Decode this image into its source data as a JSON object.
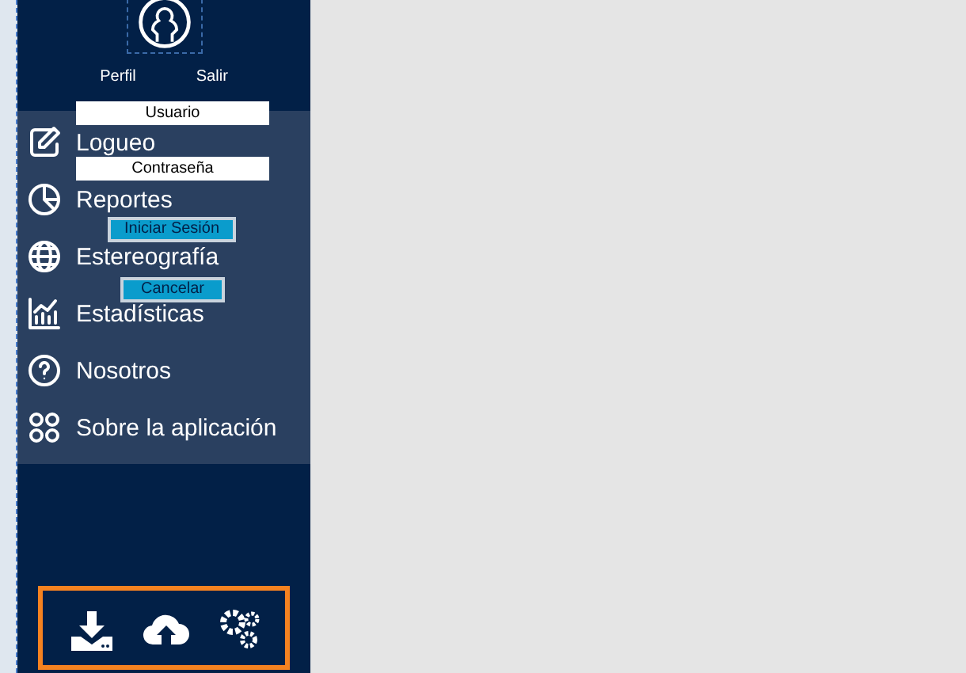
{
  "profile": {
    "links": [
      "Perfil",
      "Salir"
    ]
  },
  "login": {
    "fields": [
      {
        "value": "Usuario"
      },
      {
        "value": "Contraseña"
      }
    ],
    "buttons": [
      "Iniciar Sesión",
      "Cancelar"
    ]
  },
  "menu": {
    "items": [
      {
        "label": "Logueo"
      },
      {
        "label": "Reportes"
      },
      {
        "label": "Estereografía"
      },
      {
        "label": "Estadísticas"
      },
      {
        "label": "Nosotros"
      },
      {
        "label": "Sobre la aplicación"
      }
    ]
  }
}
